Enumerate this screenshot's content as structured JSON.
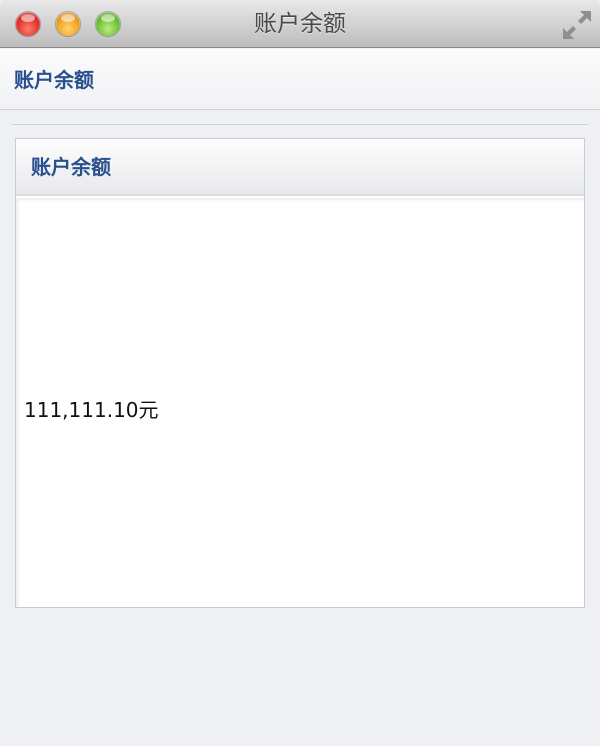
{
  "window": {
    "title": "账户余额"
  },
  "header": {
    "title": "账户余额"
  },
  "panel": {
    "title": "账户余额",
    "balance": "111,111.10元"
  },
  "colors": {
    "accent_text": "#2a4f8e",
    "background": "#eff0f4",
    "close_button": "#e0322a",
    "minimize_button": "#f0a020",
    "zoom_button": "#6cbf36"
  },
  "icons": {
    "close": "close-icon",
    "minimize": "minimize-icon",
    "zoom": "zoom-icon",
    "fullscreen": "fullscreen-arrows-icon"
  }
}
